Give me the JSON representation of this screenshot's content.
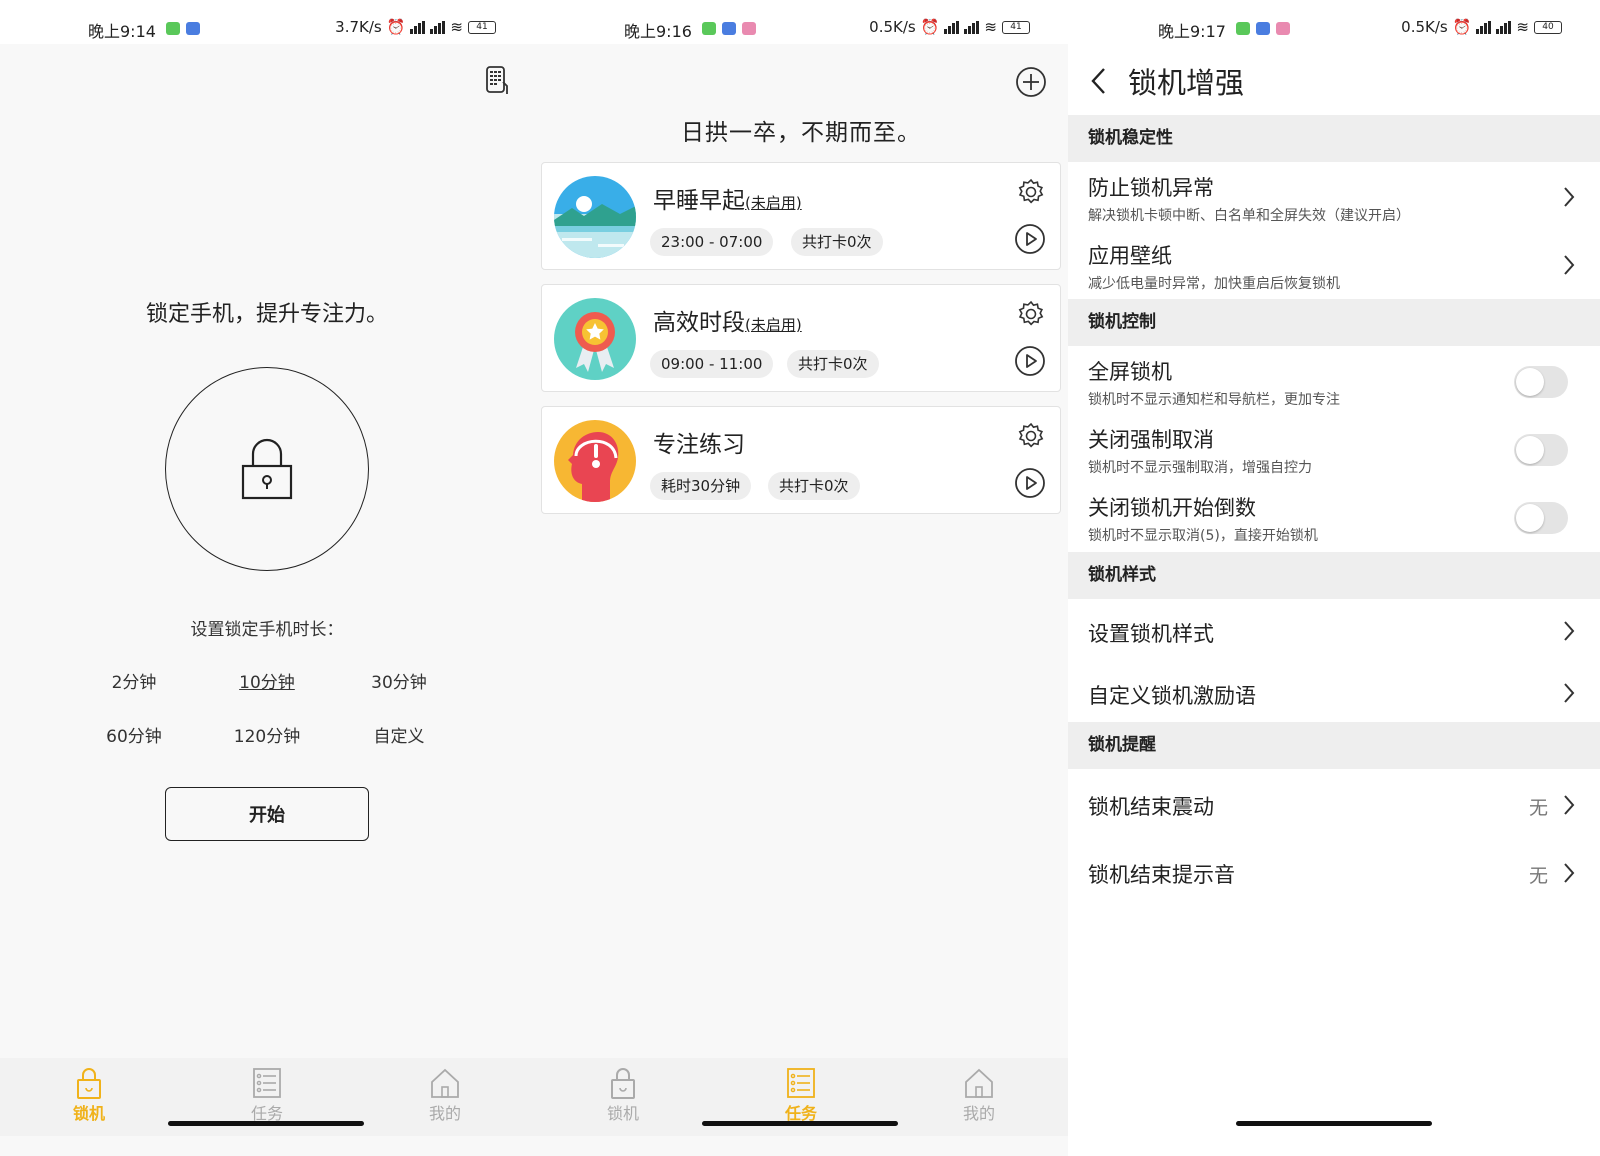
{
  "screens": [
    {
      "status": {
        "time": "晚上9:14",
        "speed": "3.7K/s",
        "battery": "41"
      },
      "slogan": "锁定手机，提升专注力。",
      "duration_title": "设置锁定手机时长：",
      "durations": [
        "2分钟",
        "10分钟",
        "30分钟",
        "60分钟",
        "120分钟",
        "自定义"
      ],
      "selected_duration": "10分钟",
      "start_label": "开始",
      "nav": [
        "锁机",
        "任务",
        "我的"
      ],
      "active_nav": "锁机"
    },
    {
      "status": {
        "time": "晚上9:16",
        "speed": "0.5K/s",
        "battery": "41"
      },
      "slogan": "日拱一卒，不期而至。",
      "tasks": [
        {
          "title": "早睡早起",
          "state": "(未启用)",
          "time": "23:00 - 07:00",
          "count": "共打卡0次"
        },
        {
          "title": "高效时段",
          "state": "(未启用)",
          "time": "09:00 - 11:00",
          "count": "共打卡0次"
        },
        {
          "title": "专注练习",
          "state": "",
          "time": "耗时30分钟",
          "count": "共打卡0次"
        }
      ],
      "nav": [
        "锁机",
        "任务",
        "我的"
      ],
      "active_nav": "任务"
    },
    {
      "status": {
        "time": "晚上9:17",
        "speed": "0.5K/s",
        "battery": "40"
      },
      "title": "锁机增强",
      "sections": [
        {
          "header": "锁机稳定性",
          "rows": [
            {
              "title": "防止锁机异常",
              "sub": "解决锁机卡顿中断、白名单和全屏失效（建议开启）"
            },
            {
              "title": "应用壁纸",
              "sub": "减少低电量时异常，加快重启后恢复锁机"
            }
          ]
        },
        {
          "header": "锁机控制",
          "rows": [
            {
              "title": "全屏锁机",
              "sub": "锁机时不显示通知栏和导航栏，更加专注",
              "on": false
            },
            {
              "title": "关闭强制取消",
              "sub": "锁机时不显示强制取消，增强自控力",
              "on": false
            },
            {
              "title": "关闭锁机开始倒数",
              "sub": "锁机时不显示取消(5)，直接开始锁机",
              "on": false
            }
          ]
        },
        {
          "header": "锁机样式",
          "rows": [
            {
              "title": "设置锁机样式"
            },
            {
              "title": "自定义锁机激励语"
            }
          ]
        },
        {
          "header": "锁机提醒",
          "rows": [
            {
              "title": "锁机结束震动",
              "value": "无"
            },
            {
              "title": "锁机结束提示音",
              "value": "无"
            }
          ]
        }
      ]
    }
  ],
  "colors": {
    "accent": "#f0b21a",
    "inactive": "#aaaaaa",
    "section_bg": "#eeeeee"
  }
}
